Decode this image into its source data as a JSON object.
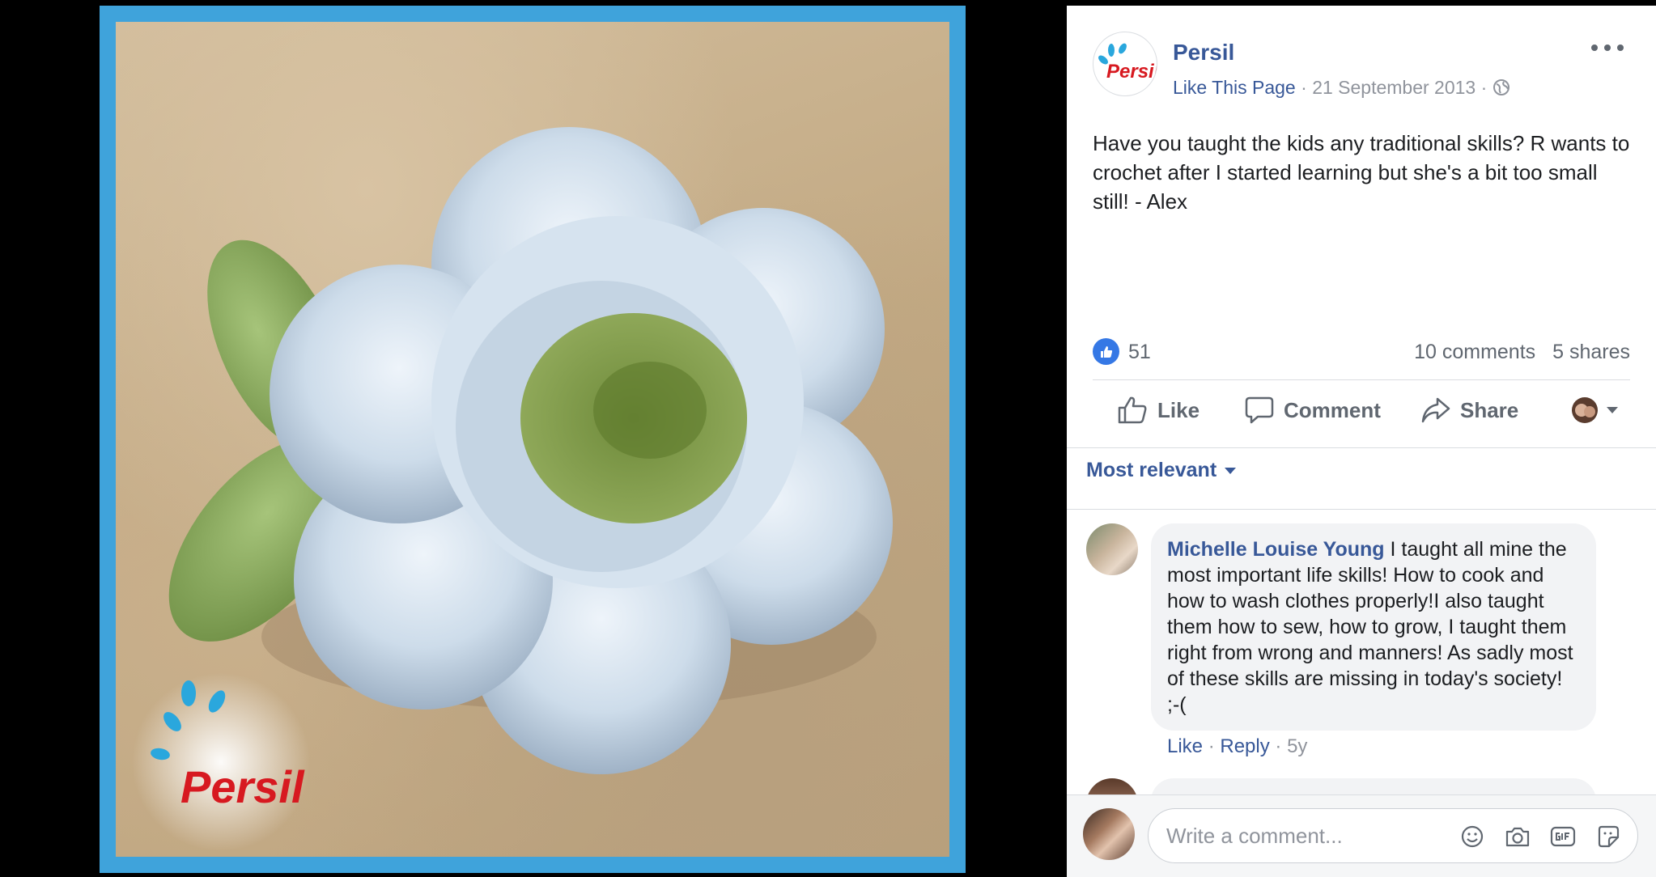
{
  "photo": {
    "watermark_brand": "Persil"
  },
  "post": {
    "page_name": "Persil",
    "like_page": "Like This Page",
    "separator": "·",
    "date": "21 September 2013",
    "text": "Have you taught the kids any traditional skills? R wants to crochet after I started learning but she's a bit too small still! - Alex",
    "reactions_count": "51",
    "comments_count": "10 comments",
    "shares_count": "5 shares"
  },
  "actions": {
    "like": "Like",
    "comment": "Comment",
    "share": "Share"
  },
  "sort": {
    "label": "Most relevant"
  },
  "comments": [
    {
      "author": "Michelle Louise Young",
      "text": "I taught all mine the most important life skills! How to cook and how to wash clothes properly!I also taught them how to sew, how to grow, I taught them right from wrong and manners! As sadly most of these skills are missing in today's society! ;-(",
      "like": "Like",
      "reply": "Reply",
      "age": "5y",
      "separator": "·"
    }
  ],
  "composer": {
    "placeholder": "Write a comment..."
  },
  "icons": {
    "like": "thumbs-up-icon",
    "comment": "speech-bubble-icon",
    "share": "share-arrow-icon",
    "globe": "globe-icon",
    "more": "more-options-icon",
    "emoji": "emoji-icon",
    "camera": "camera-icon",
    "gif": "gif-icon",
    "sticker": "sticker-icon"
  },
  "colors": {
    "link": "#385898",
    "frame": "#3fa3db",
    "like_blue": "#3578e5"
  }
}
